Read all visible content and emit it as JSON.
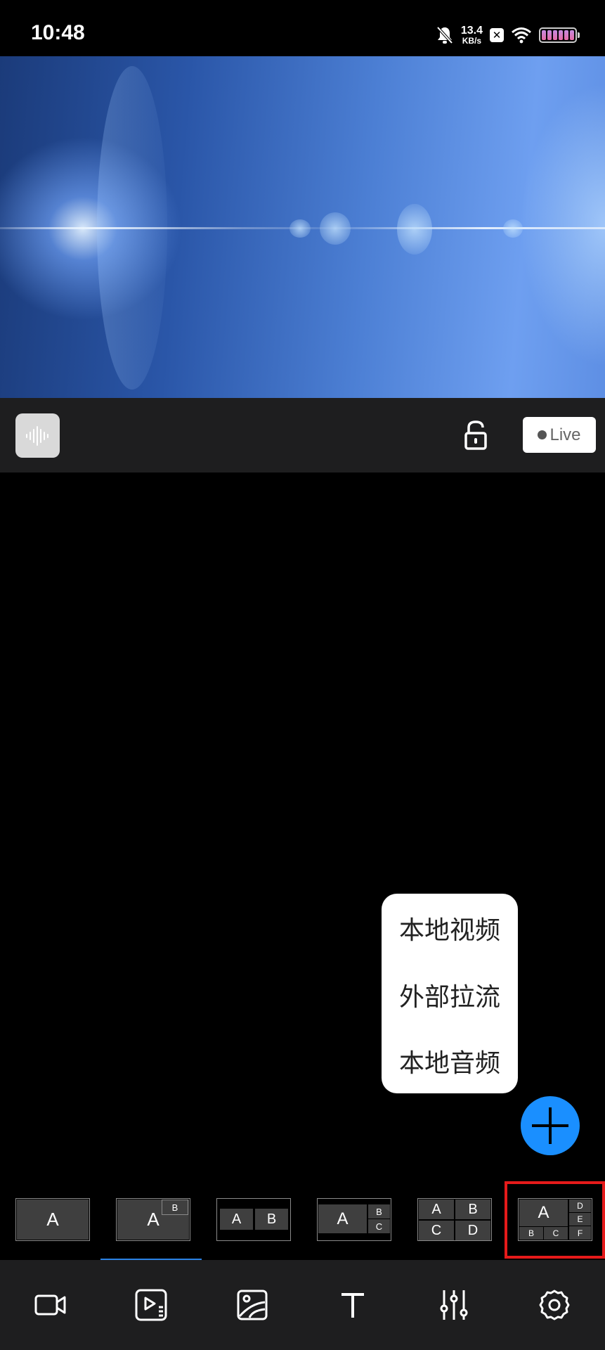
{
  "status_bar": {
    "time": "10:48",
    "net_speed_value": "13.4",
    "net_speed_unit": "KB/s",
    "icons": [
      "bell-off-icon",
      "x-notification-icon",
      "wifi-icon",
      "battery-icon"
    ]
  },
  "controls": {
    "audio_icon": "audio-waveform-icon",
    "lock_icon": "unlock-icon",
    "live_label": "Live"
  },
  "add_menu": {
    "items": [
      "本地视频",
      "外部拉流",
      "本地音频"
    ],
    "fab_icon": "plus-icon"
  },
  "layouts": [
    {
      "name": "layout-single",
      "labels": [
        "A"
      ]
    },
    {
      "name": "layout-pip",
      "labels": [
        "A",
        "B"
      ]
    },
    {
      "name": "layout-split-2",
      "labels": [
        "A",
        "B"
      ]
    },
    {
      "name": "layout-main-2",
      "labels": [
        "A",
        "B",
        "C"
      ]
    },
    {
      "name": "layout-grid-4",
      "labels": [
        "A",
        "B",
        "C",
        "D"
      ]
    },
    {
      "name": "layout-main-5",
      "labels": [
        "A",
        "B",
        "C",
        "D",
        "E",
        "F"
      ],
      "selected": true
    }
  ],
  "bottom_nav": {
    "active_index": 1,
    "items": [
      "camera-icon",
      "video-playlist-icon",
      "image-icon",
      "text-icon",
      "mixer-sliders-icon",
      "settings-gear-icon"
    ]
  },
  "colors": {
    "accent": "#1a8fff",
    "selection": "#e51a1a",
    "tab_indicator": "#2b83e6",
    "bar_background": "#1e1e1f"
  }
}
